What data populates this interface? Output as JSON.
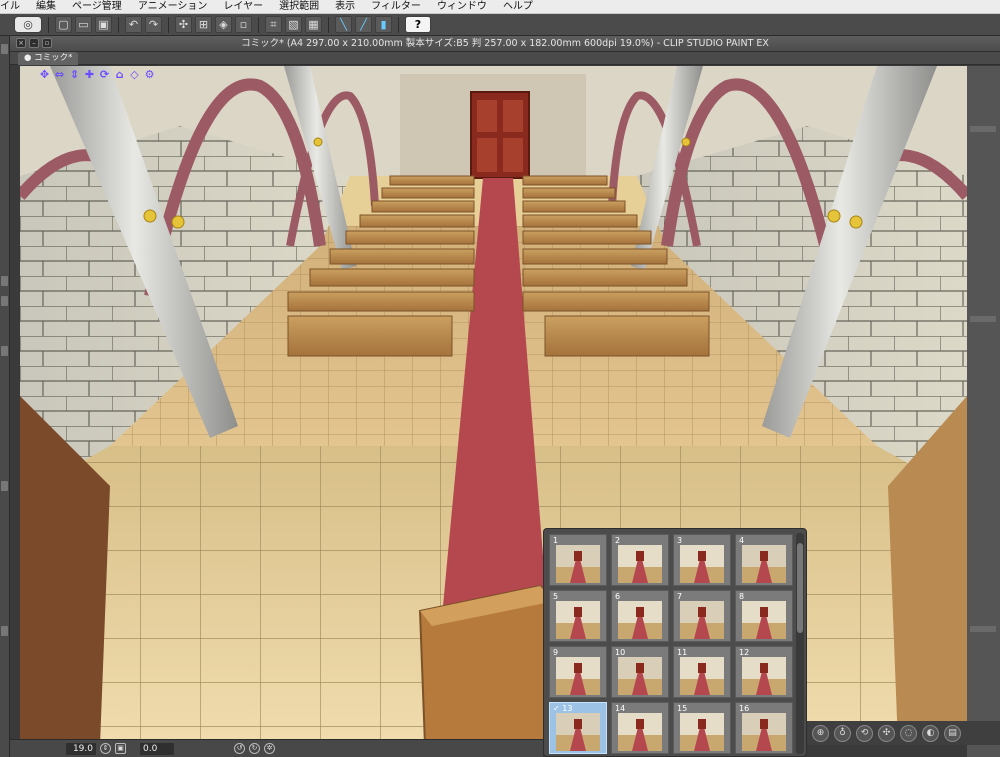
{
  "menubar": {
    "items": [
      "イル",
      "編集",
      "ページ管理",
      "アニメーション",
      "レイヤー",
      "選択範囲",
      "表示",
      "フィルター",
      "ウィンドウ",
      "ヘルプ"
    ]
  },
  "toolbar": {
    "help_label": "?"
  },
  "window": {
    "title": "コミック* (A4 297.00 x 210.00mm 製本サイズ:B5 判 257.00 x 182.00mm 600dpi 19.0%) - CLIP STUDIO PAINT EX",
    "tab_label": "● コミック*"
  },
  "statusbar": {
    "zoom": "19.0",
    "angle": "0.0"
  },
  "thumbnails": {
    "items": [
      {
        "label": "1"
      },
      {
        "label": "2"
      },
      {
        "label": "3"
      },
      {
        "label": "4"
      },
      {
        "label": "5"
      },
      {
        "label": "6"
      },
      {
        "label": "7"
      },
      {
        "label": "8"
      },
      {
        "label": "9"
      },
      {
        "label": "10"
      },
      {
        "label": "11"
      },
      {
        "label": "12"
      },
      {
        "label": "✓ 13"
      },
      {
        "label": "14"
      },
      {
        "label": "15"
      },
      {
        "label": "16"
      }
    ],
    "selected_index": 12
  },
  "colors": {
    "accent_select": "#9cc3e6",
    "carpet": "#b5474f",
    "floor": "#e7cf98",
    "bench": "#b67a3c"
  }
}
